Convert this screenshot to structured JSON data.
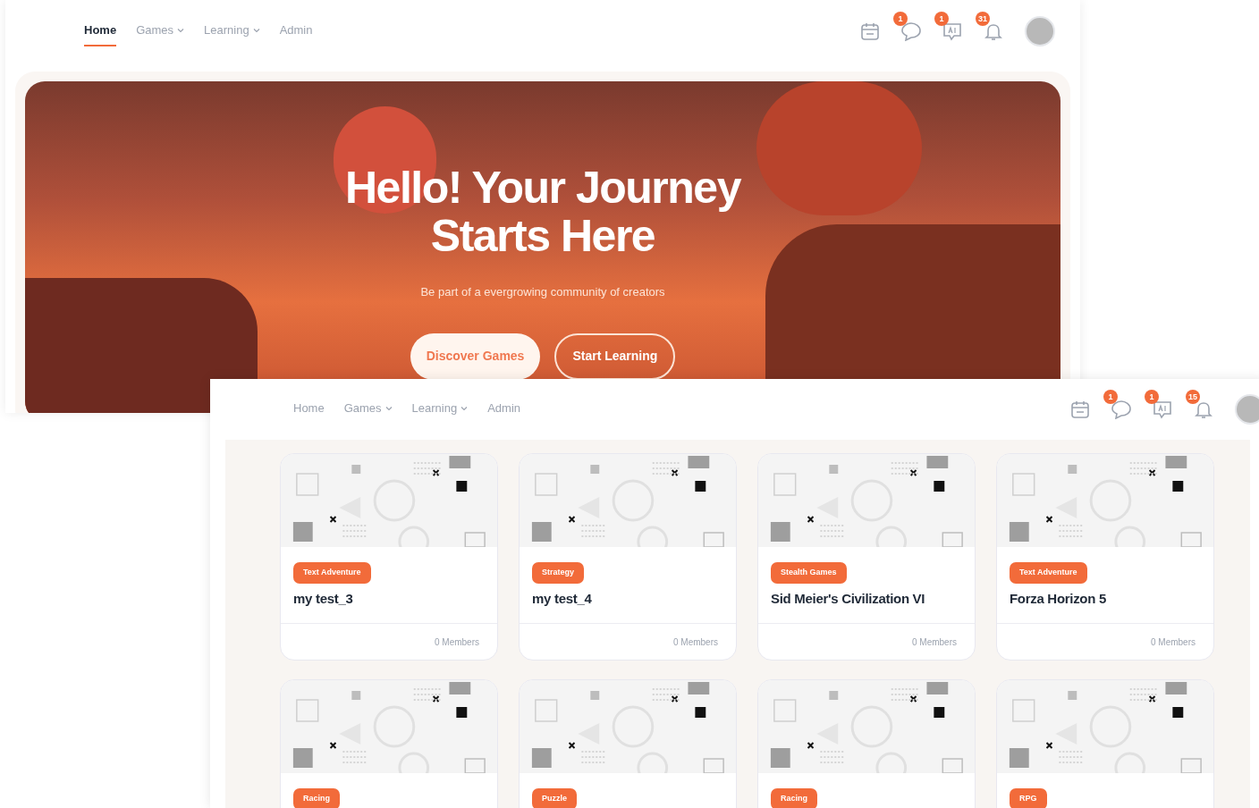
{
  "screens": [
    {
      "nav": [
        {
          "label": "Home",
          "selected": true,
          "dropdown": false
        },
        {
          "label": "Games",
          "selected": false,
          "dropdown": true
        },
        {
          "label": "Learning",
          "selected": false,
          "dropdown": true
        },
        {
          "label": "Admin",
          "selected": false,
          "dropdown": false
        }
      ],
      "toolbar": [
        {
          "kind": "calendar"
        },
        {
          "kind": "chat",
          "badge": "1"
        },
        {
          "kind": "ai",
          "badge": "1"
        },
        {
          "kind": "bell",
          "badge": "31"
        },
        {
          "kind": "avatar"
        }
      ],
      "hero": {
        "title_lines": [
          "Hello! Your Journey",
          "Starts Here"
        ],
        "subtitle": "Be part of a evergrowing community of creators",
        "buttons": [
          {
            "label": "Discover Games",
            "kind": "filled"
          },
          {
            "label": "Start Learning",
            "kind": "outline"
          }
        ]
      }
    },
    {
      "nav": [
        {
          "label": "Home",
          "selected": false,
          "dropdown": false
        },
        {
          "label": "Games",
          "selected": false,
          "dropdown": true
        },
        {
          "label": "Learning",
          "selected": false,
          "dropdown": true
        },
        {
          "label": "Admin",
          "selected": false,
          "dropdown": false
        }
      ],
      "toolbar": [
        {
          "kind": "calendar"
        },
        {
          "kind": "chat",
          "badge": "1"
        },
        {
          "kind": "ai",
          "badge": "1"
        },
        {
          "kind": "bell",
          "badge": "15"
        },
        {
          "kind": "avatar"
        }
      ],
      "cards": [
        {
          "tag": "Text Adventure",
          "title": "my test_3",
          "members": "0 Members"
        },
        {
          "tag": "Strategy",
          "title": "my test_4",
          "members": "0 Members"
        },
        {
          "tag": "Stealth Games",
          "title": "Sid Meier's Civilization VI",
          "members": "0 Members"
        },
        {
          "tag": "Text Adventure",
          "title": "Forza Horizon 5",
          "members": "0 Members"
        },
        {
          "tag": "Racing"
        },
        {
          "tag": "Puzzle"
        },
        {
          "tag": "Racing"
        },
        {
          "tag": "RPG"
        }
      ]
    }
  ]
}
